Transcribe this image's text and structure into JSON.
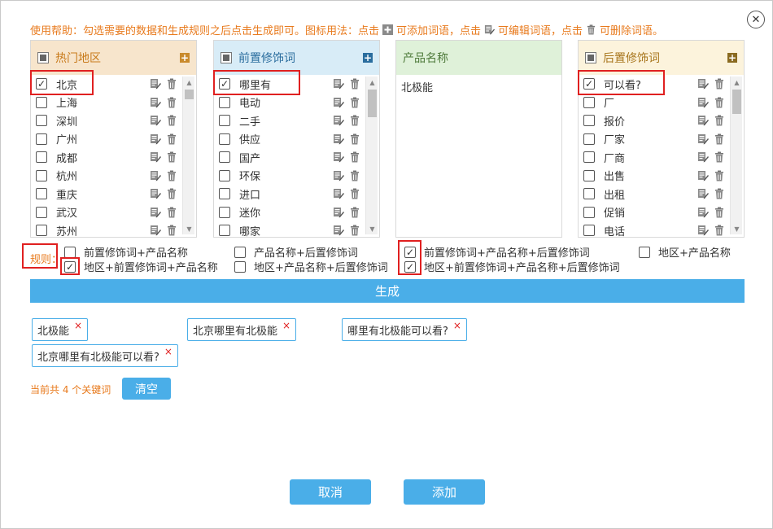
{
  "help": {
    "prefix": "使用帮助：勾选需要的数据和生成规则之后点击生成即可。图标用法：点击",
    "add_text": "可添加词语，点击",
    "edit_text": "可编辑词语，点击",
    "delete_text": "可删除词语。"
  },
  "close_label": "✕",
  "colors": {
    "accent": "#4aaee8",
    "orange": "#e87a1d",
    "red_highlight": "#e02020",
    "region_head_bg": "#f7e5cc",
    "prefix_head_bg": "#d8ecf7",
    "product_head_bg": "#dff1d9",
    "suffix_head_bg": "#fcf3dc"
  },
  "panels": {
    "region": {
      "title": "热门地区",
      "items": [
        {
          "label": "北京",
          "checked": true
        },
        {
          "label": "上海",
          "checked": false
        },
        {
          "label": "深圳",
          "checked": false
        },
        {
          "label": "广州",
          "checked": false
        },
        {
          "label": "成都",
          "checked": false
        },
        {
          "label": "杭州",
          "checked": false
        },
        {
          "label": "重庆",
          "checked": false
        },
        {
          "label": "武汉",
          "checked": false
        },
        {
          "label": "苏州",
          "checked": false
        }
      ]
    },
    "prefix": {
      "title": "前置修饰词",
      "items": [
        {
          "label": "哪里有",
          "checked": true
        },
        {
          "label": "电动",
          "checked": false
        },
        {
          "label": "二手",
          "checked": false
        },
        {
          "label": "供应",
          "checked": false
        },
        {
          "label": "国产",
          "checked": false
        },
        {
          "label": "环保",
          "checked": false
        },
        {
          "label": "进口",
          "checked": false
        },
        {
          "label": "迷你",
          "checked": false
        },
        {
          "label": "哪家",
          "checked": false
        }
      ]
    },
    "product": {
      "title": "产品名称",
      "items": [
        {
          "label": "北极能"
        }
      ]
    },
    "suffix": {
      "title": "后置修饰词",
      "items": [
        {
          "label": "可以看?",
          "checked": true
        },
        {
          "label": "厂",
          "checked": false
        },
        {
          "label": "报价",
          "checked": false
        },
        {
          "label": "厂家",
          "checked": false
        },
        {
          "label": "厂商",
          "checked": false
        },
        {
          "label": "出售",
          "checked": false
        },
        {
          "label": "出租",
          "checked": false
        },
        {
          "label": "促销",
          "checked": false
        },
        {
          "label": "电话",
          "checked": false
        }
      ]
    }
  },
  "rules": {
    "label": "规则：",
    "items": [
      {
        "label": "前置修饰词+产品名称",
        "checked": false
      },
      {
        "label": "产品名称+后置修饰词",
        "checked": false
      },
      {
        "label": "前置修饰词+产品名称+后置修饰词",
        "checked": true
      },
      {
        "label": "地区+产品名称",
        "checked": false
      },
      {
        "label": "地区+前置修饰词+产品名称",
        "checked": true
      },
      {
        "label": "地区+产品名称+后置修饰词",
        "checked": false
      },
      {
        "label": "地区+前置修饰词+产品名称+后置修饰词",
        "checked": true
      }
    ]
  },
  "generate_label": "生成",
  "results": [
    "北极能",
    "北京哪里有北极能",
    "哪里有北极能可以看?",
    "北京哪里有北极能可以看?"
  ],
  "remove_glyph": "×",
  "count_text": "当前共 4 个关键词",
  "clear_label": "清空",
  "cancel_label": "取消",
  "add_label": "添加"
}
